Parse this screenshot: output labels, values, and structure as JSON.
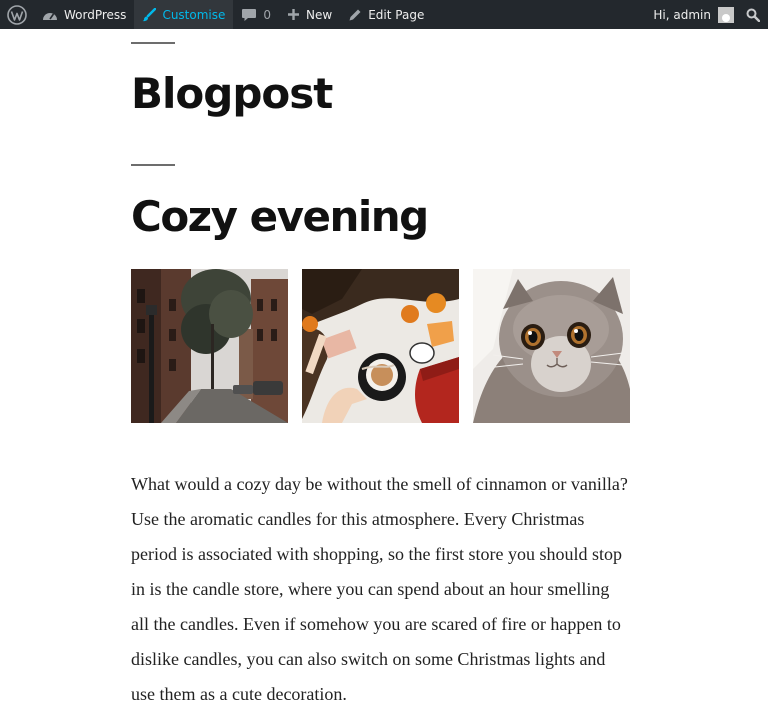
{
  "adminbar": {
    "items": [
      {
        "name": "wordpress-logo",
        "icon": "wordpress-icon",
        "label": ""
      },
      {
        "name": "site-name",
        "icon": "dashboard-icon",
        "label": "WordPress"
      },
      {
        "name": "customise",
        "icon": "brush-icon",
        "label": "Customise"
      },
      {
        "name": "comments",
        "icon": "comment-icon",
        "label": "0"
      },
      {
        "name": "new",
        "icon": "plus-icon",
        "label": "New"
      },
      {
        "name": "edit-page",
        "icon": "pencil-icon",
        "label": "Edit Page"
      }
    ],
    "greeting": "Hi, admin",
    "search_icon": "search-icon"
  },
  "page": {
    "title": "Blogpost"
  },
  "post": {
    "title": "Cozy evening",
    "gallery": [
      {
        "icon": "street-photo"
      },
      {
        "icon": "coffee-flatlay-photo"
      },
      {
        "icon": "kitten-photo"
      }
    ],
    "body": "What would a cozy day be without the smell of cinnamon or vanilla? Use the aromatic candles for this atmosphere. Every Christmas period is associated with shopping, so the first store you should stop in is the candle store, where you can spend about an hour smelling all the candles. Even if somehow you are scared of fire or happen to dislike candles, you can also switch on some Christmas lights and use them as a cute decoration."
  },
  "colors": {
    "adminbar_bg": "#23282d",
    "adminbar_active": "#00b9eb",
    "rule": "#6d6d6d"
  }
}
